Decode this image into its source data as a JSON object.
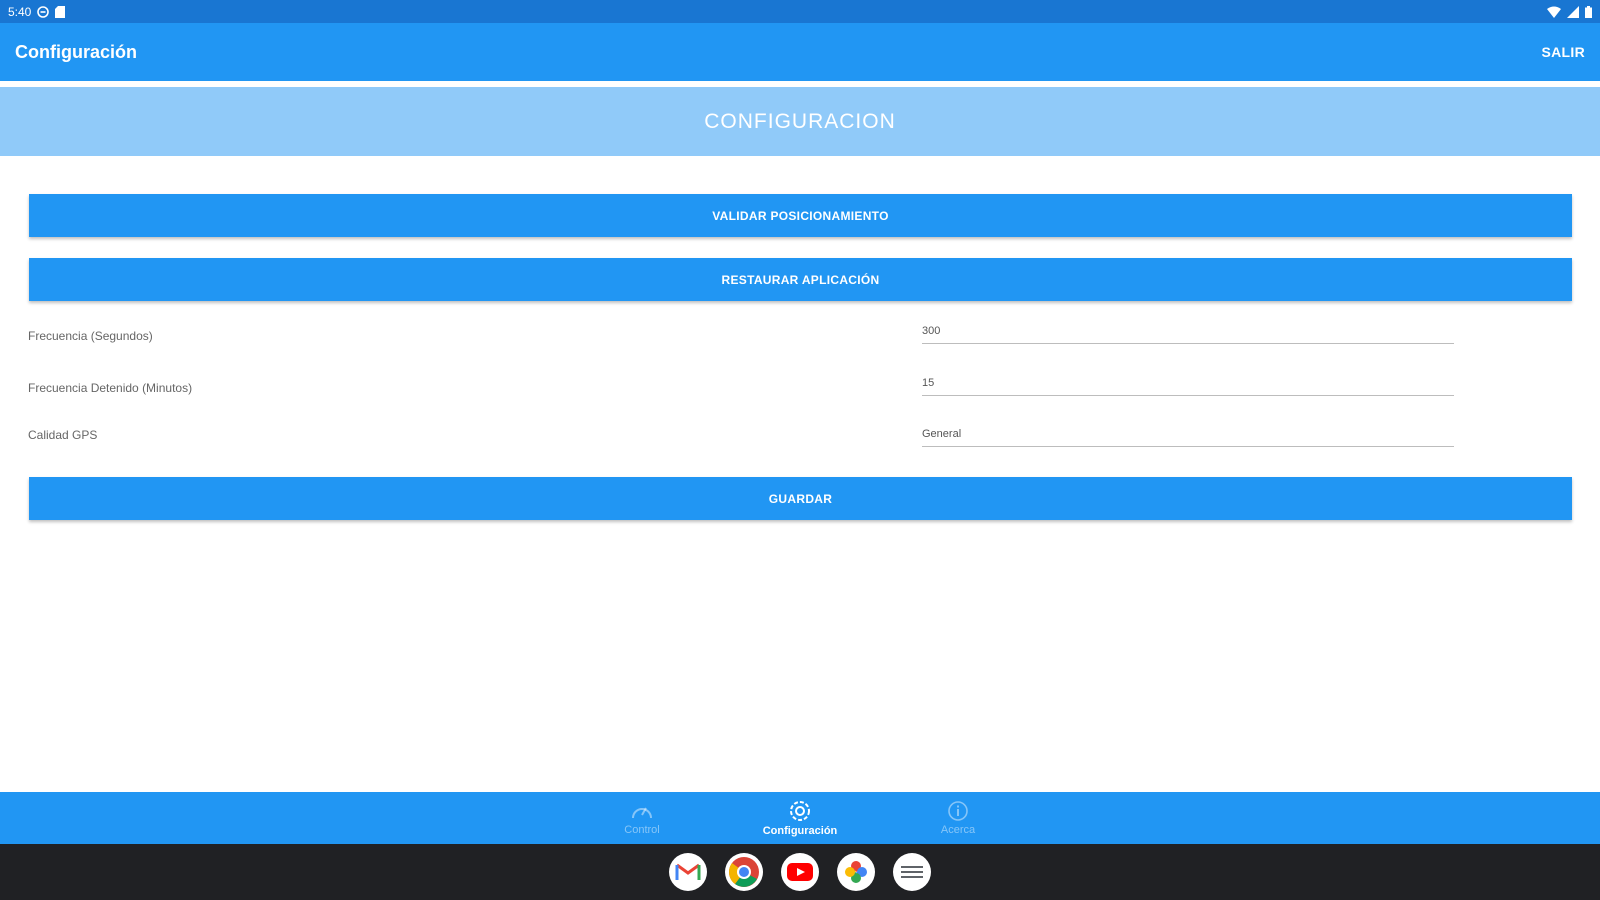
{
  "status_bar": {
    "time": "5:40"
  },
  "app_bar": {
    "title": "Configuración",
    "action": "SALIR"
  },
  "header": {
    "title": "CONFIGURACION"
  },
  "buttons": {
    "validate": "VALIDAR POSICIONAMIENTO",
    "restore": "RESTAURAR APLICACIÓN",
    "save": "GUARDAR"
  },
  "settings": [
    {
      "label": "Frecuencia (Segundos)",
      "value": "300"
    },
    {
      "label": "Frecuencia Detenido (Minutos)",
      "value": "15"
    },
    {
      "label": "Calidad GPS",
      "value": "General"
    }
  ],
  "nav": [
    {
      "label": "Control",
      "icon": "speedometer-icon",
      "active": false
    },
    {
      "label": "Configuración",
      "icon": "gear-icon",
      "active": true
    },
    {
      "label": "Acerca",
      "icon": "info-icon",
      "active": false
    }
  ],
  "dock": [
    "gmail-icon",
    "chrome-icon",
    "youtube-icon",
    "photos-icon",
    "app-drawer-icon"
  ],
  "colors": {
    "primary": "#2196f3",
    "primary_dark": "#1976d2",
    "header_band": "#90caf9",
    "dock_bg": "#202124"
  }
}
